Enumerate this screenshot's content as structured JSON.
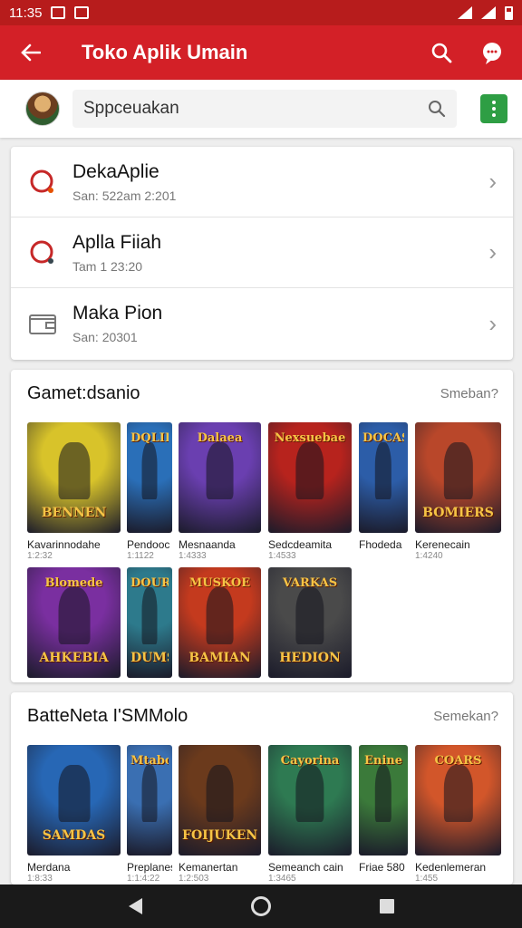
{
  "status": {
    "time": "11:35"
  },
  "app_bar": {
    "title": "Toko Aplik Umain"
  },
  "search": {
    "placeholder": "Sppceuakan"
  },
  "list": [
    {
      "title": "DekaAplie",
      "subtitle": "San: 522am 2:201",
      "icon": "circle-badge-icon"
    },
    {
      "title": "Aplla Fiiah",
      "subtitle": "Tam 1 23:20",
      "icon": "circle-badge-icon"
    },
    {
      "title": "Maka Pion",
      "subtitle": "San: 20301",
      "icon": "wallet-icon"
    }
  ],
  "sections": [
    {
      "title": "Gamet:dsanio",
      "more": "Smeban?",
      "rows": [
        [
          {
            "name": "Kavarinnodahe",
            "meta": "1:2:32",
            "top": "",
            "label": "BENNEN",
            "color": "#d8c32a"
          },
          {
            "name": "Pendooc",
            "meta": "1:1122",
            "top": "DQLIRS",
            "label": "",
            "color": "#2a6fb8"
          },
          {
            "name": "Mesnaanda",
            "meta": "1:4333",
            "top": "Dalaea",
            "label": "",
            "color": "#6a3fb0"
          },
          {
            "name": "Sedcdeamita",
            "meta": "1:4533",
            "top": "Nexsuebae",
            "label": "",
            "color": "#b7231d"
          },
          {
            "name": "Fhodeda",
            "meta": "",
            "top": "DOCAS",
            "label": "",
            "color": "#2c5da8"
          },
          {
            "name": "Kerenecain",
            "meta": "1:4240",
            "top": "",
            "label": "BOMIERS",
            "color": "#b9472a"
          }
        ],
        [
          {
            "name": "",
            "meta": "",
            "top": "Blomede",
            "label": "AHKEBIA",
            "color": "#7a2fa0"
          },
          {
            "name": "",
            "meta": "",
            "top": "DOURIE",
            "label": "DUMSDE",
            "color": "#2d7a8c"
          },
          {
            "name": "",
            "meta": "",
            "top": "MUSKOE",
            "label": "BAMIAN",
            "color": "#c43a1e"
          },
          {
            "name": "",
            "meta": "",
            "top": "VARKAS",
            "label": "HEDION",
            "color": "#4a4a4a"
          }
        ]
      ]
    },
    {
      "title": "BatteNeta I'SMMolo",
      "more": "Semekan?",
      "rows": [
        [
          {
            "name": "Merdana",
            "meta": "1:8:33",
            "top": "",
            "label": "SAMDAS",
            "color": "#2767b5"
          },
          {
            "name": "Preplanes",
            "meta": "1:1:4:22",
            "top": "Mtabos",
            "label": "",
            "color": "#3a6fb2"
          },
          {
            "name": "Kemanertan",
            "meta": "1:2:503",
            "top": "",
            "label": "FOIJUKEN",
            "color": "#6b3a1c"
          },
          {
            "name": "Semeanch cain",
            "meta": "1:3465",
            "top": "Cayorina",
            "label": "",
            "color": "#2e7a52"
          },
          {
            "name": "Friae 580",
            "meta": "",
            "top": "Enine",
            "label": "",
            "color": "#3b7a3a"
          },
          {
            "name": "Kedenlemeran",
            "meta": "1:455",
            "top": "COARS",
            "label": "",
            "color": "#d2562a"
          }
        ]
      ]
    }
  ]
}
